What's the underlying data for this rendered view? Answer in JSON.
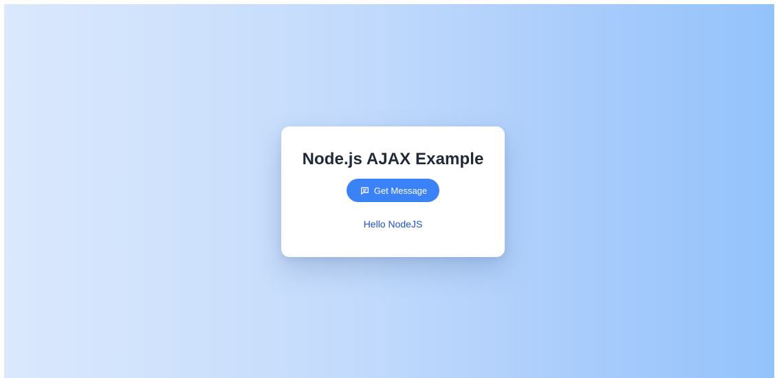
{
  "card": {
    "title": "Node.js AJAX Example",
    "button_label": "Get Message",
    "button_icon": "message-square-icon",
    "message": "Hello NodeJS"
  },
  "colors": {
    "accent": "#3b82f6",
    "message_text": "#1d4fc4",
    "title_text": "#1f2937",
    "background_start": "#dbe8fd",
    "background_end": "#93c3fb"
  }
}
